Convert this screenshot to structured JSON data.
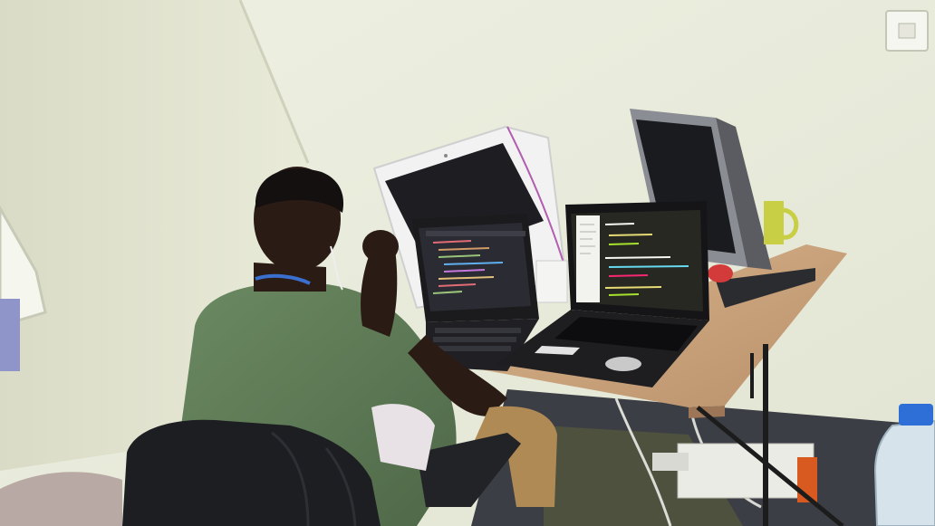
{
  "scene": {
    "kind": "photograph",
    "colors": {
      "wall_left": "#e6e7d4",
      "wall_right": "#eceedf",
      "desk_top": "#c9a57f",
      "shirt": "#5d7a55",
      "skin": "#2a1c15",
      "laptop_body": "#1b1b1d",
      "screen_dark": "#2a2b33",
      "code_bg": "#272822",
      "chair": "#1d1e22",
      "lanyard": "#3a6fd0",
      "monitor_grey": "#8a8d94",
      "white_laptop": "#f2f2f2"
    },
    "icons": [
      "light-switch-icon",
      "water-bottle-icon"
    ]
  }
}
